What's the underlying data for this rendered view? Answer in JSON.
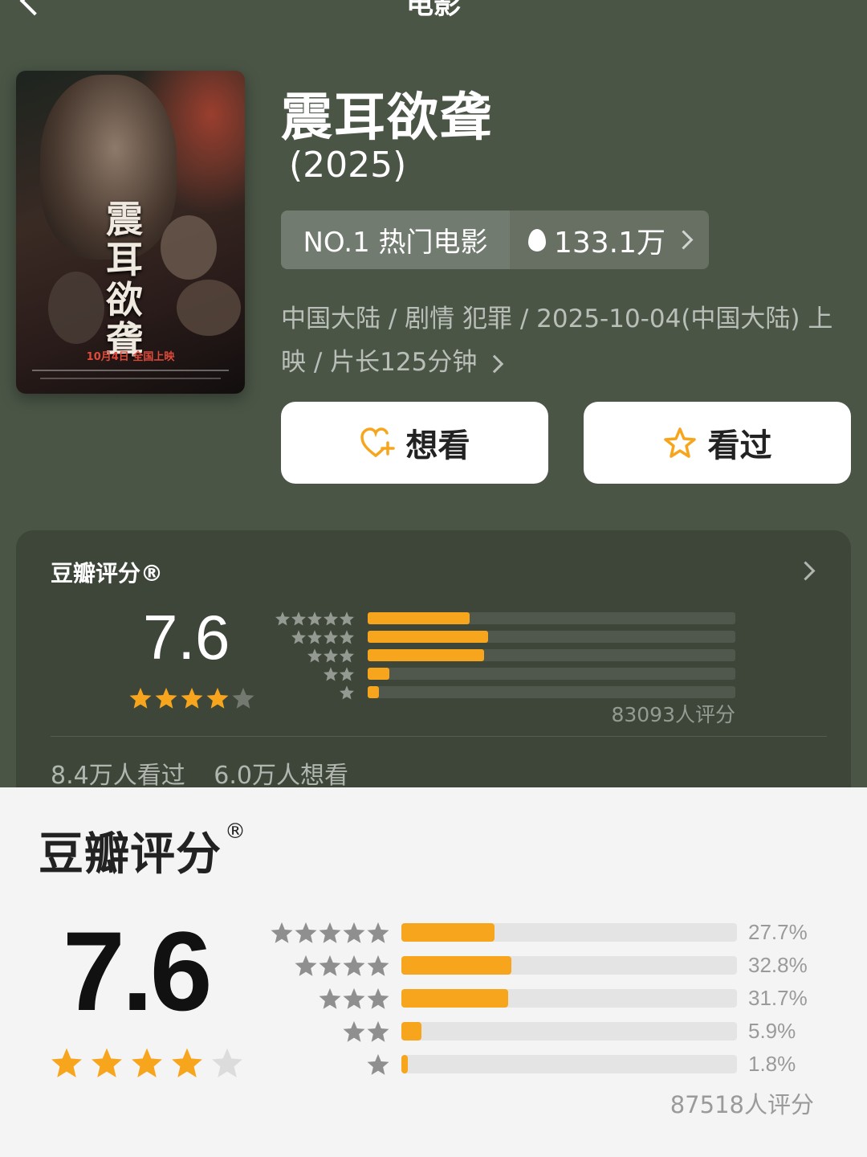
{
  "nav": {
    "title": "电影"
  },
  "movie": {
    "title": "震耳欲聋",
    "year": "(2025)",
    "hot_rank": "NO.1 热门电影",
    "hot_count": "133.1万",
    "meta_line1": "中国大陆 / 剧情 犯罪 / 2025-10-04(中国大陆) 上",
    "meta_line2": "映 / 片长125分钟",
    "poster": {
      "title_chars": "震耳欲聋",
      "date_text": "10月4日 全国上映"
    }
  },
  "actions": {
    "want_label": "想看",
    "seen_label": "看过"
  },
  "rating_card": {
    "label": "豆瓣评分®",
    "score": "7.6",
    "star_rating": 4,
    "distribution_fraction": [
      0.277,
      0.328,
      0.317,
      0.059,
      0.018
    ],
    "count_text": "83093人评分",
    "seen_text": "8.4万人看过",
    "want_text": "6.0万人想看"
  },
  "rating_detail": {
    "label": "豆瓣评分",
    "registered_mark": "®",
    "score": "7.6",
    "star_rating": 4,
    "rows": [
      {
        "stars": 5,
        "fraction": 0.277,
        "pct": "27.7%"
      },
      {
        "stars": 4,
        "fraction": 0.328,
        "pct": "32.8%"
      },
      {
        "stars": 3,
        "fraction": 0.317,
        "pct": "31.7%"
      },
      {
        "stars": 2,
        "fraction": 0.059,
        "pct": "5.9%"
      },
      {
        "stars": 1,
        "fraction": 0.018,
        "pct": "1.8%"
      }
    ],
    "count_text": "87518人评分"
  },
  "colors": {
    "accent": "#f7a51c",
    "header_bg": "#4a5546",
    "card_bg": "#3d4639"
  }
}
